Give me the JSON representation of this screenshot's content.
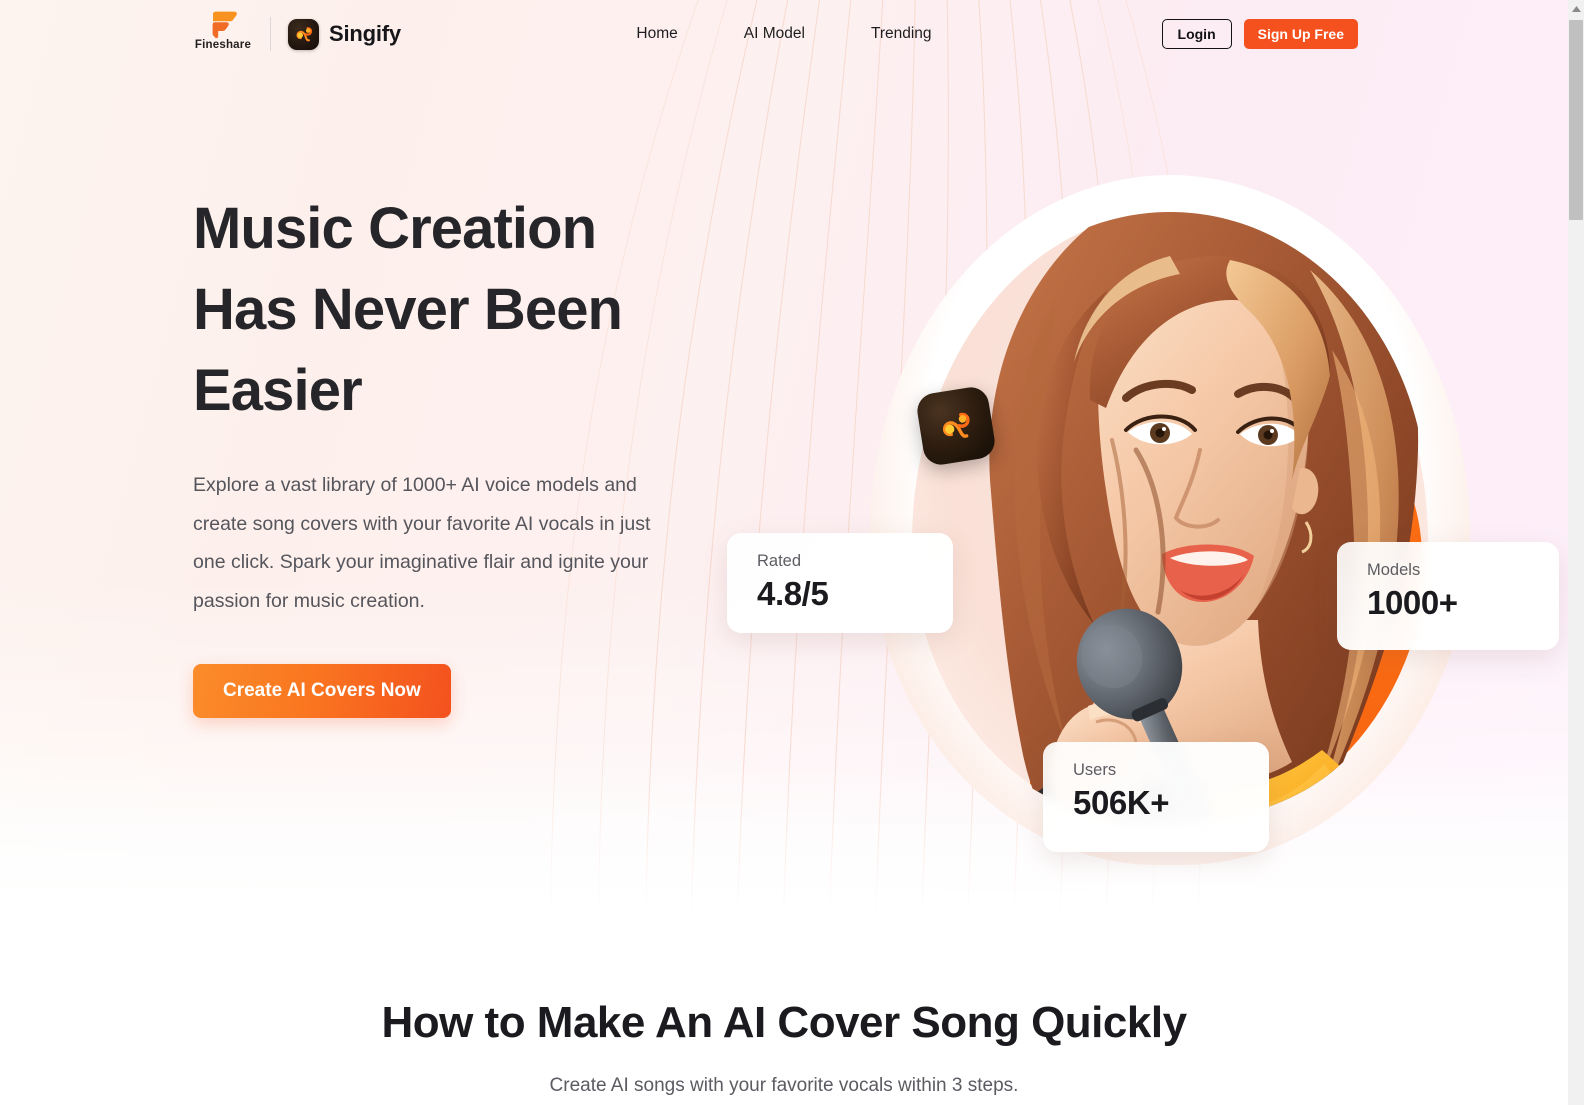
{
  "header": {
    "brand": {
      "fineshare_name": "Fineshare",
      "fineshare_icon": "fineshare-speech-bubble-logo",
      "product_icon": "singify-app-icon",
      "product_name": "Singify"
    },
    "nav": [
      {
        "label": "Home"
      },
      {
        "label": "AI Model"
      },
      {
        "label": "Trending"
      }
    ],
    "login_label": "Login",
    "signup_label": "Sign Up Free"
  },
  "hero": {
    "title_lines": [
      "Music Creation",
      "Has Never Been",
      "Easier"
    ],
    "title": "Music Creation Has Never Been Easier",
    "description": "Explore a vast library of 1000+ AI voice models and create song covers with your favorite AI vocals in just one click. Spark your imaginative flair and ignite your passion for music creation.",
    "cta_label": "Create AI Covers Now",
    "artwork_alt": "illustration-of-woman-singing-into-microphone",
    "mic_logo_icon": "singify-mic-badge-icon",
    "stats": [
      {
        "label": "Rated",
        "value": "4.8/5"
      },
      {
        "label": "Models",
        "value": "1000+"
      },
      {
        "label": "Users",
        "value": "506K+"
      }
    ]
  },
  "howto": {
    "title": "How to Make An AI Cover Song Quickly",
    "subtitle": "Create AI songs with your favorite vocals within 3 steps."
  },
  "scrollbar": {
    "up_arrow_icon": "scroll-up-arrow-icon"
  },
  "colors": {
    "brand_orange": "#f4511e",
    "cta_gradient_from": "#fb8c2a",
    "cta_gradient_to": "#f4511e",
    "bg_left": "#fdf2ee",
    "bg_right": "#fdeff9",
    "text_dark": "#26262a",
    "text_muted": "#55555c"
  }
}
